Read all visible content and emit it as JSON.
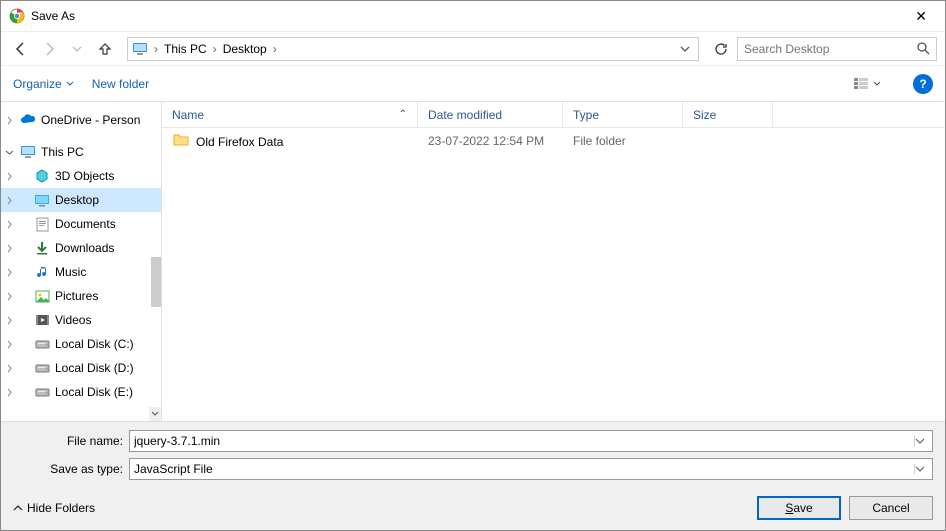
{
  "title": "Save As",
  "breadcrumbs": [
    "This PC",
    "Desktop"
  ],
  "search_placeholder": "Search Desktop",
  "toolbar": {
    "organize": "Organize",
    "newfolder": "New folder"
  },
  "tree": [
    {
      "exp": ">",
      "indent": 0,
      "icon": "onedrive",
      "label": "OneDrive - Person",
      "selected": false,
      "gapBefore": 0
    },
    {
      "exp": "v",
      "indent": 0,
      "icon": "pc",
      "label": "This PC",
      "selected": false,
      "gapBefore": 8
    },
    {
      "exp": ">",
      "indent": 1,
      "icon": "3d",
      "label": "3D Objects",
      "selected": false,
      "gapBefore": 0
    },
    {
      "exp": ">",
      "indent": 1,
      "icon": "desktop",
      "label": "Desktop",
      "selected": true,
      "gapBefore": 0
    },
    {
      "exp": ">",
      "indent": 1,
      "icon": "docs",
      "label": "Documents",
      "selected": false,
      "gapBefore": 0
    },
    {
      "exp": ">",
      "indent": 1,
      "icon": "down",
      "label": "Downloads",
      "selected": false,
      "gapBefore": 0
    },
    {
      "exp": ">",
      "indent": 1,
      "icon": "music",
      "label": "Music",
      "selected": false,
      "gapBefore": 0
    },
    {
      "exp": ">",
      "indent": 1,
      "icon": "pics",
      "label": "Pictures",
      "selected": false,
      "gapBefore": 0
    },
    {
      "exp": ">",
      "indent": 1,
      "icon": "vids",
      "label": "Videos",
      "selected": false,
      "gapBefore": 0
    },
    {
      "exp": ">",
      "indent": 1,
      "icon": "disk",
      "label": "Local Disk (C:)",
      "selected": false,
      "gapBefore": 0
    },
    {
      "exp": ">",
      "indent": 1,
      "icon": "disk",
      "label": "Local Disk (D:)",
      "selected": false,
      "gapBefore": 0
    },
    {
      "exp": ">",
      "indent": 1,
      "icon": "disk",
      "label": "Local Disk (E:)",
      "selected": false,
      "gapBefore": 0
    }
  ],
  "columns": {
    "name": "Name",
    "date": "Date modified",
    "type": "Type",
    "size": "Size"
  },
  "rows": [
    {
      "icon": "folder",
      "name": "Old Firefox Data",
      "date": "23-07-2022 12:54 PM",
      "type": "File folder",
      "size": ""
    }
  ],
  "filename_label": "File name:",
  "filetype_label": "Save as type:",
  "filename_value": "jquery-3.7.1.min",
  "filetype_value": "JavaScript File",
  "hide_folders": "Hide Folders",
  "save_btn": "Save",
  "cancel_btn": "Cancel"
}
